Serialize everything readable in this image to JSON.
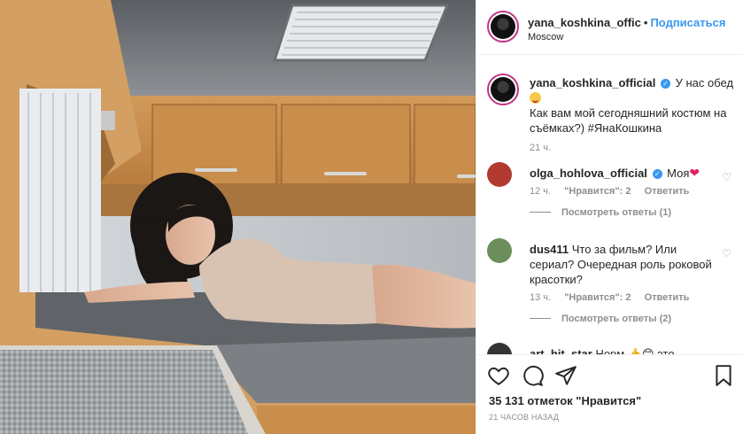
{
  "post": {
    "username": "yana_koshkina_offic",
    "follow_label": "Подписаться",
    "location": "Moscow"
  },
  "caption": {
    "username": "yana_koshkina_official",
    "text_line1": "У нас обед",
    "text_rest": "Как вам мой сегодняшний костюм на съёмках?) #ЯнаКошкина",
    "time": "21 ч."
  },
  "comments": [
    {
      "username": "olga_hohlova_official",
      "text": "Моя",
      "time": "12 ч.",
      "likes_label": "\"Нравится\": 2",
      "reply_label": "Ответить",
      "view_replies": "Посмотреть ответы (1)",
      "avatar_color": "#c0392b"
    },
    {
      "username": "dus411",
      "text": "Что за фильм? Или сериал? Очередная роль роковой красотки?",
      "time": "13 ч.",
      "likes_label": "\"Нравится\": 2",
      "reply_label": "Ответить",
      "view_replies": "Посмотреть ответы (2)",
      "avatar_color": "#6b8e5a"
    },
    {
      "username": "art_hit_star",
      "text": "Норм 👍😊 это",
      "avatar_color": "#333333"
    }
  ],
  "actions": {
    "like_icon": "heart-outline-icon",
    "comment_icon": "comment-icon",
    "share_icon": "share-icon",
    "save_icon": "bookmark-icon",
    "likes_text": "35 131 отметок \"Нравится\"",
    "time_ago": "21 ЧАСОВ НАЗАД"
  },
  "colors": {
    "link_blue": "#3897f0",
    "story_ring": "#c13584",
    "verified": "#3897f0"
  }
}
